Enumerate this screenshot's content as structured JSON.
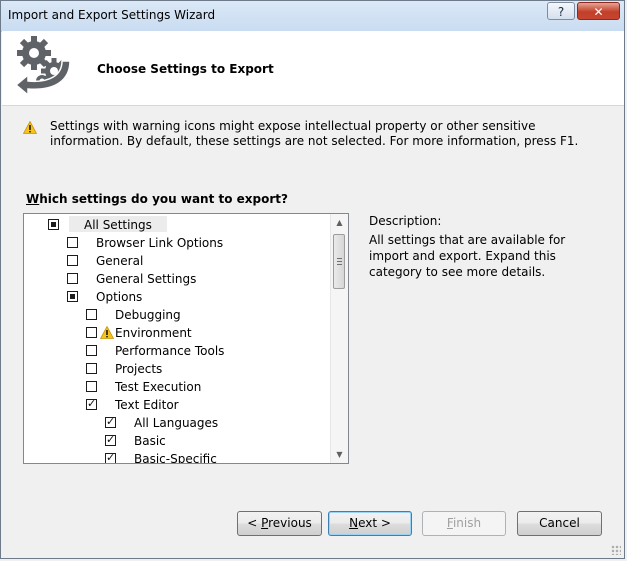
{
  "window": {
    "title": "Import and Export Settings Wizard",
    "help_button": "?",
    "close_button": "✕"
  },
  "header": {
    "title": "Choose Settings to Export"
  },
  "warning": {
    "icon": "warning-icon",
    "text": "Settings with warning icons might expose intellectual property or other sensitive information. By default, these settings are not selected. For more information, press F1."
  },
  "question": {
    "accesskey": "W",
    "rest": "hich settings do you want to export?"
  },
  "tree": {
    "items": [
      {
        "label": "All Settings",
        "state": "indeterminate",
        "level": 0,
        "warning": false
      },
      {
        "label": "Browser Link Options",
        "state": "unchecked",
        "level": 1,
        "warning": false
      },
      {
        "label": "General",
        "state": "unchecked",
        "level": 1,
        "warning": false
      },
      {
        "label": "General Settings",
        "state": "unchecked",
        "level": 1,
        "warning": false
      },
      {
        "label": "Options",
        "state": "indeterminate",
        "level": 1,
        "warning": false
      },
      {
        "label": "Debugging",
        "state": "unchecked",
        "level": 2,
        "warning": false
      },
      {
        "label": "Environment",
        "state": "unchecked",
        "level": 2,
        "warning": true
      },
      {
        "label": "Performance Tools",
        "state": "unchecked",
        "level": 2,
        "warning": false
      },
      {
        "label": "Projects",
        "state": "unchecked",
        "level": 2,
        "warning": false
      },
      {
        "label": "Test Execution",
        "state": "unchecked",
        "level": 2,
        "warning": false
      },
      {
        "label": "Text Editor",
        "state": "checked",
        "level": 2,
        "warning": false
      },
      {
        "label": "All Languages",
        "state": "checked",
        "level": 3,
        "warning": false
      },
      {
        "label": "Basic",
        "state": "checked",
        "level": 3,
        "warning": false
      },
      {
        "label": "Basic-Specific",
        "state": "checked",
        "level": 3,
        "warning": false
      }
    ]
  },
  "description": {
    "label": "Description:",
    "text": "All settings that are available for import and export. Expand this category to see more details."
  },
  "buttons": {
    "previous_prefix": "< ",
    "previous_key": "P",
    "previous_rest": "revious",
    "next_key": "N",
    "next_rest": "ext >",
    "finish_key": "F",
    "finish_rest": "inish",
    "cancel": "Cancel"
  },
  "colors": {
    "warning_yellow": "#f6c21b",
    "titlebar": "#c9dcf1",
    "close_red": "#c7452e"
  }
}
